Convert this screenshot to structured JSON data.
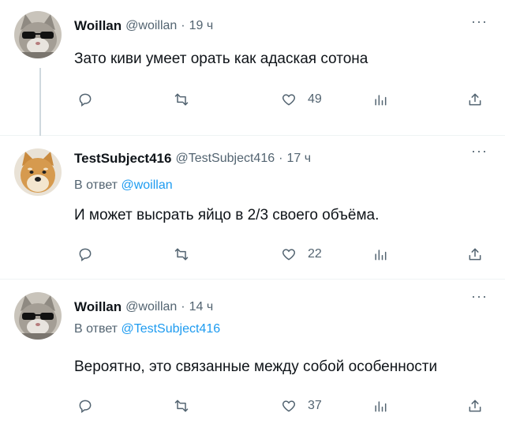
{
  "tweets": [
    {
      "author": "Woillan",
      "handle": "@woillan",
      "dot": "·",
      "time": "19 ч",
      "reply_prefix": "",
      "reply_mention": "",
      "text": "Зато киви умеет орать как адаская сотона",
      "likes": "49",
      "avatar": "cat-sunglasses"
    },
    {
      "author": "TestSubject416",
      "handle": "@TestSubject416",
      "dot": "·",
      "time": "17 ч",
      "reply_prefix": "В ответ",
      "reply_mention": "@woillan",
      "text": "И может высрать яйцо в 2/3 своего объёма.",
      "likes": "22",
      "avatar": "shiba-dog"
    },
    {
      "author": "Woillan",
      "handle": "@woillan",
      "dot": "·",
      "time": "14 ч",
      "reply_prefix": "В ответ",
      "reply_mention": "@TestSubject416",
      "text": "Вероятно, это связанные между собой особенности",
      "likes": "37",
      "avatar": "cat-sunglasses"
    }
  ],
  "more_label": "···",
  "icons": [
    "reply-icon",
    "retweet-icon",
    "like-icon",
    "stats-icon",
    "share-icon"
  ],
  "colors": {
    "text": "#0f1419",
    "secondary": "#536471",
    "link": "#1d9bf0",
    "divider": "#eff3f4"
  }
}
